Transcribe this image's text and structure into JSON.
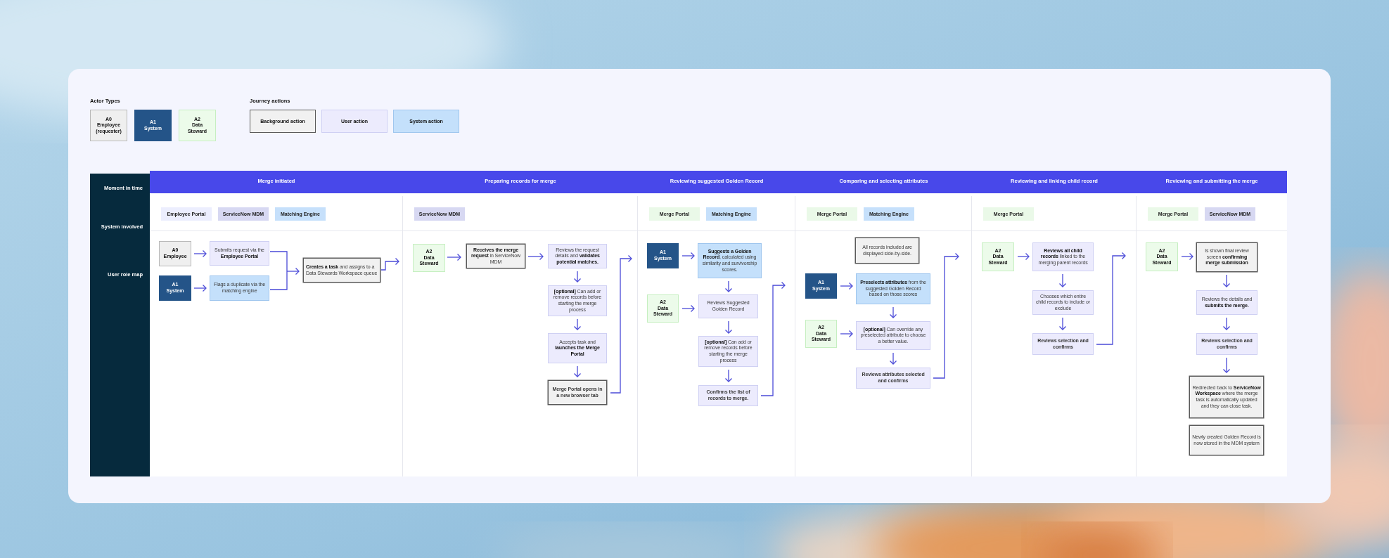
{
  "legend": {
    "actor_types": {
      "title": "Actor Types",
      "items": [
        {
          "code": "A0",
          "name": "Employee (requester)",
          "kind": "employee"
        },
        {
          "code": "A1",
          "name": "System",
          "kind": "system"
        },
        {
          "code": "A2",
          "name": "Data Steward",
          "kind": "steward"
        }
      ]
    },
    "journey_actions": {
      "title": "Journey actions",
      "items": [
        {
          "label": "Background action",
          "kind": "background"
        },
        {
          "label": "User action",
          "kind": "user"
        },
        {
          "label": "System action",
          "kind": "system"
        }
      ]
    }
  },
  "journey_map": {
    "row_labels": [
      "Moment in time",
      "System involved",
      "User role map"
    ],
    "stages": [
      {
        "moment": "Merge initiated",
        "systems": [
          {
            "label": "Employee Portal",
            "color": "#eceefe"
          },
          {
            "label": "ServiceNow MDM",
            "color": "#d7d8f2"
          },
          {
            "label": "Matching Engine",
            "color": "#c6e0fb"
          }
        ],
        "actors": [
          {
            "code": "A0",
            "name": "Employee",
            "kind": "employee"
          },
          {
            "code": "A1",
            "name": "System",
            "kind": "system"
          }
        ],
        "steps": [
          {
            "text": "Submits request via the **Employee Portal**",
            "kind": "user",
            "strong": false
          },
          {
            "text": "Flags a duplicate via the matching engine",
            "kind": "system",
            "strong": false
          },
          {
            "text": "**Creates a task** and assigns to a Data Stewards Workspace queue",
            "kind": "background",
            "strong": false
          }
        ]
      },
      {
        "moment": "Preparing records for merge",
        "systems": [
          {
            "label": "ServiceNow MDM",
            "color": "#d7d8f2"
          }
        ],
        "actors": [
          {
            "code": "A2",
            "name": "Data Steward",
            "kind": "steward"
          }
        ],
        "steps": [
          {
            "text": "**Receives the merge request** in ServiceNow MDM",
            "kind": "background",
            "strong": false
          },
          {
            "text": "Reviews the request details and **validates potential matches.**",
            "kind": "user",
            "strong": false
          },
          {
            "text": "**[optional]** Can add or remove records before starting the merge process",
            "kind": "user",
            "strong": false
          },
          {
            "text": "Accepts task and **launches the Merge Portal**",
            "kind": "user",
            "strong": false
          },
          {
            "text": "Merge Portal opens in a new browser tab",
            "kind": "background",
            "strong": true
          }
        ]
      },
      {
        "moment": "Reviewing suggested Golden Record",
        "systems": [
          {
            "label": "Merge Portal",
            "color": "#eaf9e8"
          },
          {
            "label": "Matching Engine",
            "color": "#c6e0fb"
          }
        ],
        "actors": [
          {
            "code": "A1",
            "name": "System",
            "kind": "system"
          },
          {
            "code": "A2",
            "name": "Data Steward",
            "kind": "steward"
          }
        ],
        "steps": [
          {
            "text": "**Suggests a Golden Record**, calculated using similarity and survivorship scores.",
            "kind": "system",
            "strong": false
          },
          {
            "text": "Reviews Suggested Golden Record",
            "kind": "user",
            "strong": false
          },
          {
            "text": "**[optional]** Can add or remove records before starting the merge process",
            "kind": "user",
            "strong": false
          },
          {
            "text": "Confirms the list of records to merge.",
            "kind": "user",
            "strong": true
          }
        ]
      },
      {
        "moment": "Comparing and selecting attributes",
        "systems": [
          {
            "label": "Merge Portal",
            "color": "#eaf9e8"
          },
          {
            "label": "Matching Engine",
            "color": "#c6e0fb"
          }
        ],
        "actors": [
          {
            "code": "A1",
            "name": "System",
            "kind": "system"
          },
          {
            "code": "A2",
            "name": "Data Steward",
            "kind": "steward"
          }
        ],
        "steps": [
          {
            "text": "All records included are displayed side-by-side.",
            "kind": "background",
            "strong": false
          },
          {
            "text": "**Preselects attributes** from the suggested Golden Record based on those scores",
            "kind": "system",
            "strong": false
          },
          {
            "text": "**[optional]** Can override any preselected attribute to choose a better value.",
            "kind": "user",
            "strong": false
          },
          {
            "text": "Reviews attributes selected and confirms",
            "kind": "user",
            "strong": true
          }
        ]
      },
      {
        "moment": "Reviewing and linking child record",
        "systems": [
          {
            "label": "Merge Portal",
            "color": "#eaf9e8"
          }
        ],
        "actors": [
          {
            "code": "A2",
            "name": "Data Steward",
            "kind": "steward"
          }
        ],
        "steps": [
          {
            "text": "**Reviews all child records** linked to the merging parent records",
            "kind": "user",
            "strong": false
          },
          {
            "text": "Chooses which entire child records to include or exclude",
            "kind": "user",
            "strong": false
          },
          {
            "text": "Reviews selection and confirms",
            "kind": "user",
            "strong": true
          }
        ]
      },
      {
        "moment": "Reviewing and submitting the merge",
        "systems": [
          {
            "label": "Merge Portal",
            "color": "#eaf9e8"
          },
          {
            "label": "ServiceNow MDM",
            "color": "#d7d8f2"
          }
        ],
        "actors": [
          {
            "code": "A2",
            "name": "Data Steward",
            "kind": "steward"
          }
        ],
        "steps": [
          {
            "text": "Is shown final review screen **confirming merge submission**",
            "kind": "background",
            "strong": false
          },
          {
            "text": "Reviews the details and **submits the merge.**",
            "kind": "user",
            "strong": false
          },
          {
            "text": "Reviews selection and confirms",
            "kind": "user",
            "strong": true
          },
          {
            "text": "Redirected back to **ServiceNow Workspace** where the merge task is automatically updated and they can close task.",
            "kind": "background",
            "strong": false
          },
          {
            "text": "Newly created Golden Record is now stored in the MDM system",
            "kind": "background",
            "strong": false
          }
        ]
      }
    ]
  }
}
